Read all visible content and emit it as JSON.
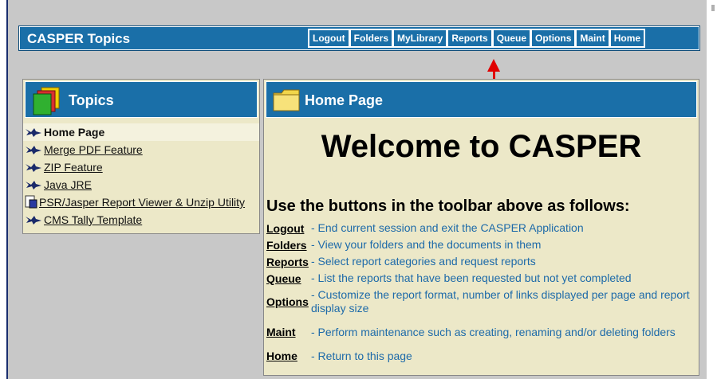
{
  "header": {
    "title": "CASPER Topics",
    "toolbar": [
      "Logout",
      "Folders",
      "MyLibrary",
      "Reports",
      "Queue",
      "Options",
      "Maint",
      "Home"
    ]
  },
  "topics": {
    "title": "Topics",
    "items": [
      {
        "label": "Home Page",
        "current": true
      },
      {
        "label": "Merge PDF Feature"
      },
      {
        "label": "ZIP Feature"
      },
      {
        "label": "Java JRE"
      },
      {
        "label": "PSR/Jasper Report Viewer & Unzip Utility"
      },
      {
        "label": "CMS Tally Template"
      }
    ]
  },
  "home": {
    "title": "Home Page",
    "welcome": "Welcome to CASPER",
    "instructions": "Use the buttons in the toolbar above as follows:",
    "commands": [
      {
        "name": "Logout",
        "desc": "- End current session and exit the CASPER Application"
      },
      {
        "name": "Folders",
        "desc": "- View your folders and the documents in them"
      },
      {
        "name": "Reports",
        "desc": "- Select report categories and request reports"
      },
      {
        "name": "Queue",
        "desc": "- List the reports that have been requested but not yet completed"
      },
      {
        "name": "Options",
        "desc": "- Customize the report format, number of links displayed per page and report display size"
      },
      {
        "name": "Maint",
        "desc": "- Perform maintenance such as creating, renaming and/or deleting folders"
      },
      {
        "name": "Home",
        "desc": "- Return to this page"
      }
    ]
  },
  "colors": {
    "header_blue": "#1a6fa8",
    "panel_bg": "#ece8c8",
    "link_text": "#1d6aa9",
    "arrow": "#e00000"
  },
  "icons": {
    "topic_bullet": "bird-icon",
    "folder": "folder-icon",
    "document": "document-icon"
  }
}
